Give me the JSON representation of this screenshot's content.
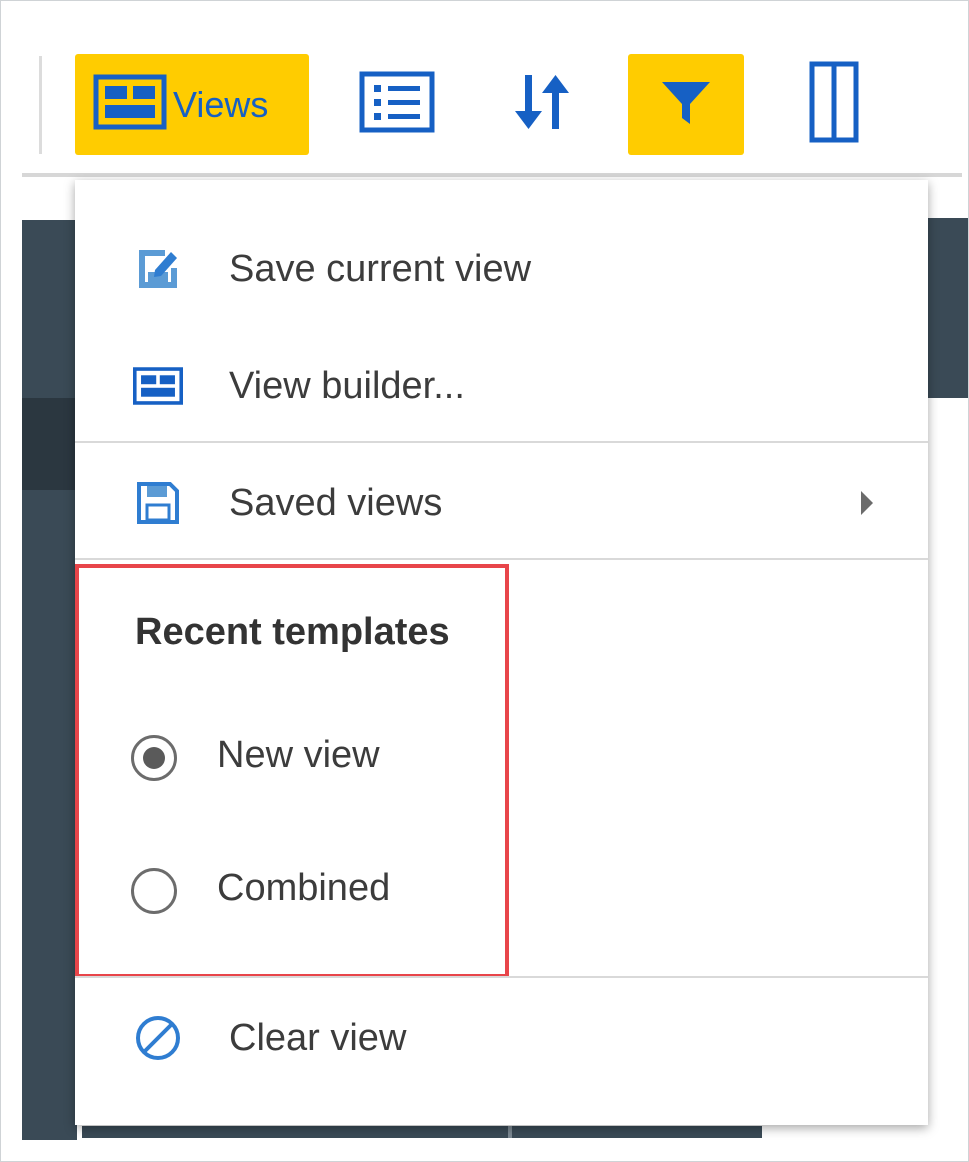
{
  "toolbar": {
    "views_label": "Views",
    "accent_color": "#ffcc00",
    "icon_color": "#1660c4"
  },
  "menu": {
    "items_top": [
      {
        "label": "Save current view",
        "icon": "save-edit-icon"
      },
      {
        "label": "View builder...",
        "icon": "view-layout-icon"
      }
    ],
    "saved_views": {
      "label": "Saved views",
      "icon": "floppy-disk-icon"
    },
    "recent_templates": {
      "title": "Recent templates",
      "options": [
        {
          "label": "New view",
          "selected": true
        },
        {
          "label": "Combined",
          "selected": false
        }
      ]
    },
    "clear_view": {
      "label": "Clear view",
      "icon": "clear-circle-icon"
    }
  }
}
